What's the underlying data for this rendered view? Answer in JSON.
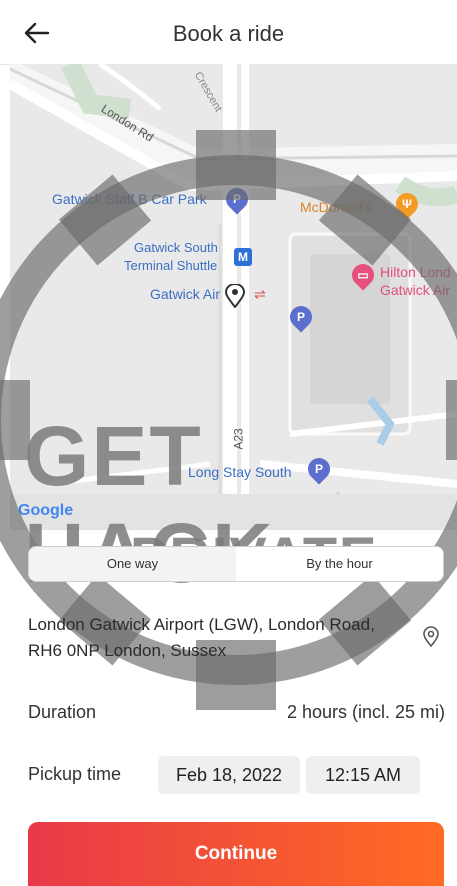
{
  "header": {
    "title": "Book a ride",
    "back_icon": "arrow-left-icon"
  },
  "map": {
    "labels": {
      "crescent": "Crescent",
      "london_rd": "London Rd",
      "staff_car_park": "Gatwick Staff B Car Park",
      "mcdonalds": "McDonald's",
      "south_shuttle_1": "Gatwick South",
      "south_shuttle_2": "Terminal Shuttle",
      "gatwick_air": "Gatwick Air",
      "hilton_1": "Hilton Lond",
      "hilton_2": "Gatwick Air",
      "a23": "A23",
      "long_stay": "Long Stay South",
      "google": "Google"
    },
    "pin_letters": {
      "parking": "P",
      "metro": "M"
    }
  },
  "watermark": {
    "line1": "GET HACK",
    "line2": "PRIVATE"
  },
  "tabs": {
    "one_way": "One way",
    "by_the_hour": "By the hour",
    "active": "By the hour"
  },
  "pickup": {
    "address": "London Gatwick Airport (LGW), London Road, RH6 0NP London, Sussex",
    "icon": "location-pin-icon"
  },
  "duration": {
    "label": "Duration",
    "value": "2 hours (incl. 25 mi)"
  },
  "pickup_time": {
    "label": "Pickup time",
    "date": "Feb 18, 2022",
    "time": "12:15 AM"
  },
  "continue_label": "Continue",
  "colors": {
    "accent_start": "#e83a48",
    "accent_end": "#ff6b22",
    "map_label": "#3b6fc4"
  }
}
